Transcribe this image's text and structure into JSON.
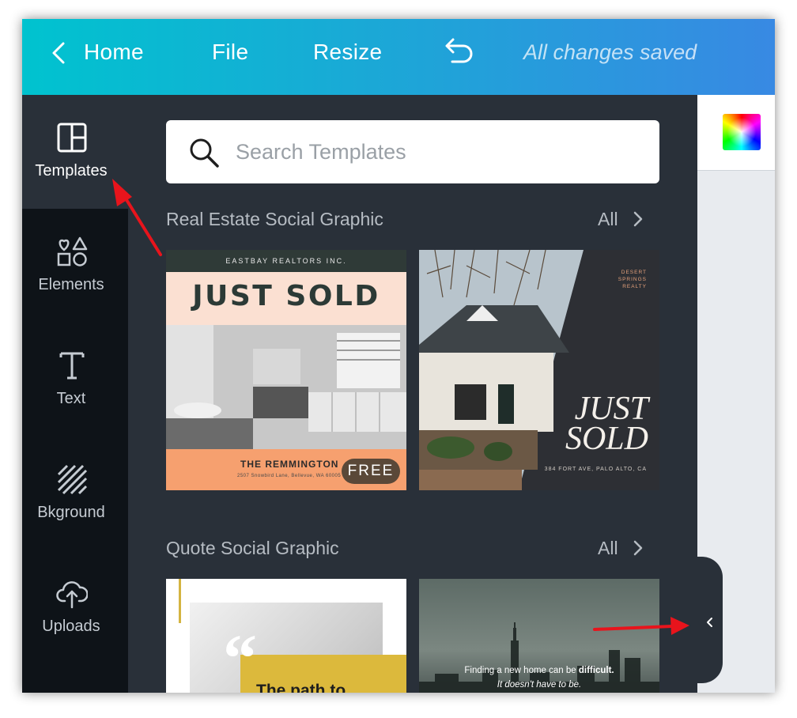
{
  "topbar": {
    "home_label": "Home",
    "file_label": "File",
    "resize_label": "Resize",
    "status_text": "All changes saved"
  },
  "sidebar": {
    "items": [
      {
        "label": "Templates",
        "icon": "templates-icon",
        "active": true
      },
      {
        "label": "Elements",
        "icon": "elements-icon",
        "active": false
      },
      {
        "label": "Text",
        "icon": "text-icon",
        "active": false
      },
      {
        "label": "Bkground",
        "icon": "background-icon",
        "active": false
      },
      {
        "label": "Uploads",
        "icon": "uploads-icon",
        "active": false
      }
    ]
  },
  "search": {
    "placeholder": "Search Templates",
    "value": ""
  },
  "sections": [
    {
      "title": "Real Estate Social Graphic",
      "all_label": "All",
      "templates": [
        {
          "header": "EASTBAY REALTORS INC.",
          "headline": "JUST SOLD",
          "name": "THE REMMINGTON",
          "address": "2507 Snowbird Lane, Bellevue, WA 60005",
          "badge": "FREE"
        },
        {
          "realty": [
            "DESERT",
            "SPRINGS",
            "REALTY"
          ],
          "headline_line1": "JUST",
          "headline_line2": "SOLD",
          "address": "384 FORT AVE, PALO ALTO, CA"
        }
      ]
    },
    {
      "title": "Quote Social Graphic",
      "all_label": "All",
      "templates": [
        {
          "quote_mark": "“",
          "text": "The path to"
        },
        {
          "line1_prefix": "Finding a new home can be ",
          "line1_bold": "difficult.",
          "line2": "It doesn't have to be."
        }
      ]
    }
  ],
  "colors": {
    "topbar_start": "#00c3cf",
    "topbar_end": "#3889e3",
    "rail_bg": "#0e1318",
    "panel_bg": "#293039",
    "annotation_arrow": "#e8141c"
  }
}
